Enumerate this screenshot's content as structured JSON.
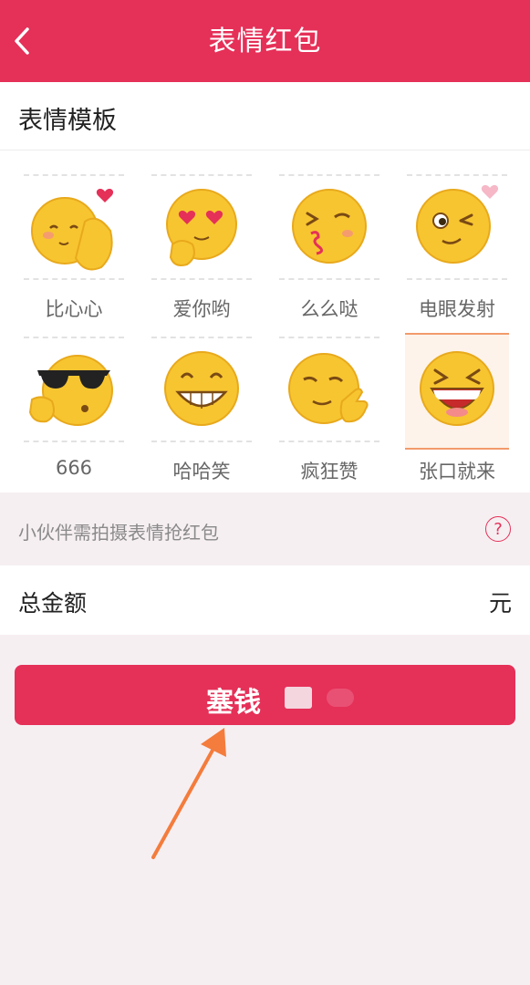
{
  "header": {
    "title": "表情红包"
  },
  "templates": {
    "section_title": "表情模板",
    "items": [
      {
        "label": "比心心",
        "icon": "finger-heart-emoji-icon"
      },
      {
        "label": "爱你哟",
        "icon": "heart-eyes-emoji-icon"
      },
      {
        "label": "么么哒",
        "icon": "kiss-emoji-icon"
      },
      {
        "label": "电眼发射",
        "icon": "wink-emoji-icon"
      },
      {
        "label": "666",
        "icon": "sunglasses-emoji-icon"
      },
      {
        "label": "哈哈笑",
        "icon": "grin-emoji-icon"
      },
      {
        "label": "疯狂赞",
        "icon": "thumbs-up-emoji-icon"
      },
      {
        "label": "张口就来",
        "icon": "laughing-emoji-icon",
        "selected": true
      }
    ]
  },
  "hint": {
    "text": "小伙伴需拍摄表情抢红包",
    "help_icon": "question-icon",
    "help_symbol": "?"
  },
  "amount": {
    "label": "总金额",
    "unit": "元",
    "value": ""
  },
  "submit": {
    "label": "塞钱"
  },
  "colors": {
    "accent": "#e53058",
    "background": "#f6eff2",
    "annotation_arrow": "#f47c3c"
  }
}
